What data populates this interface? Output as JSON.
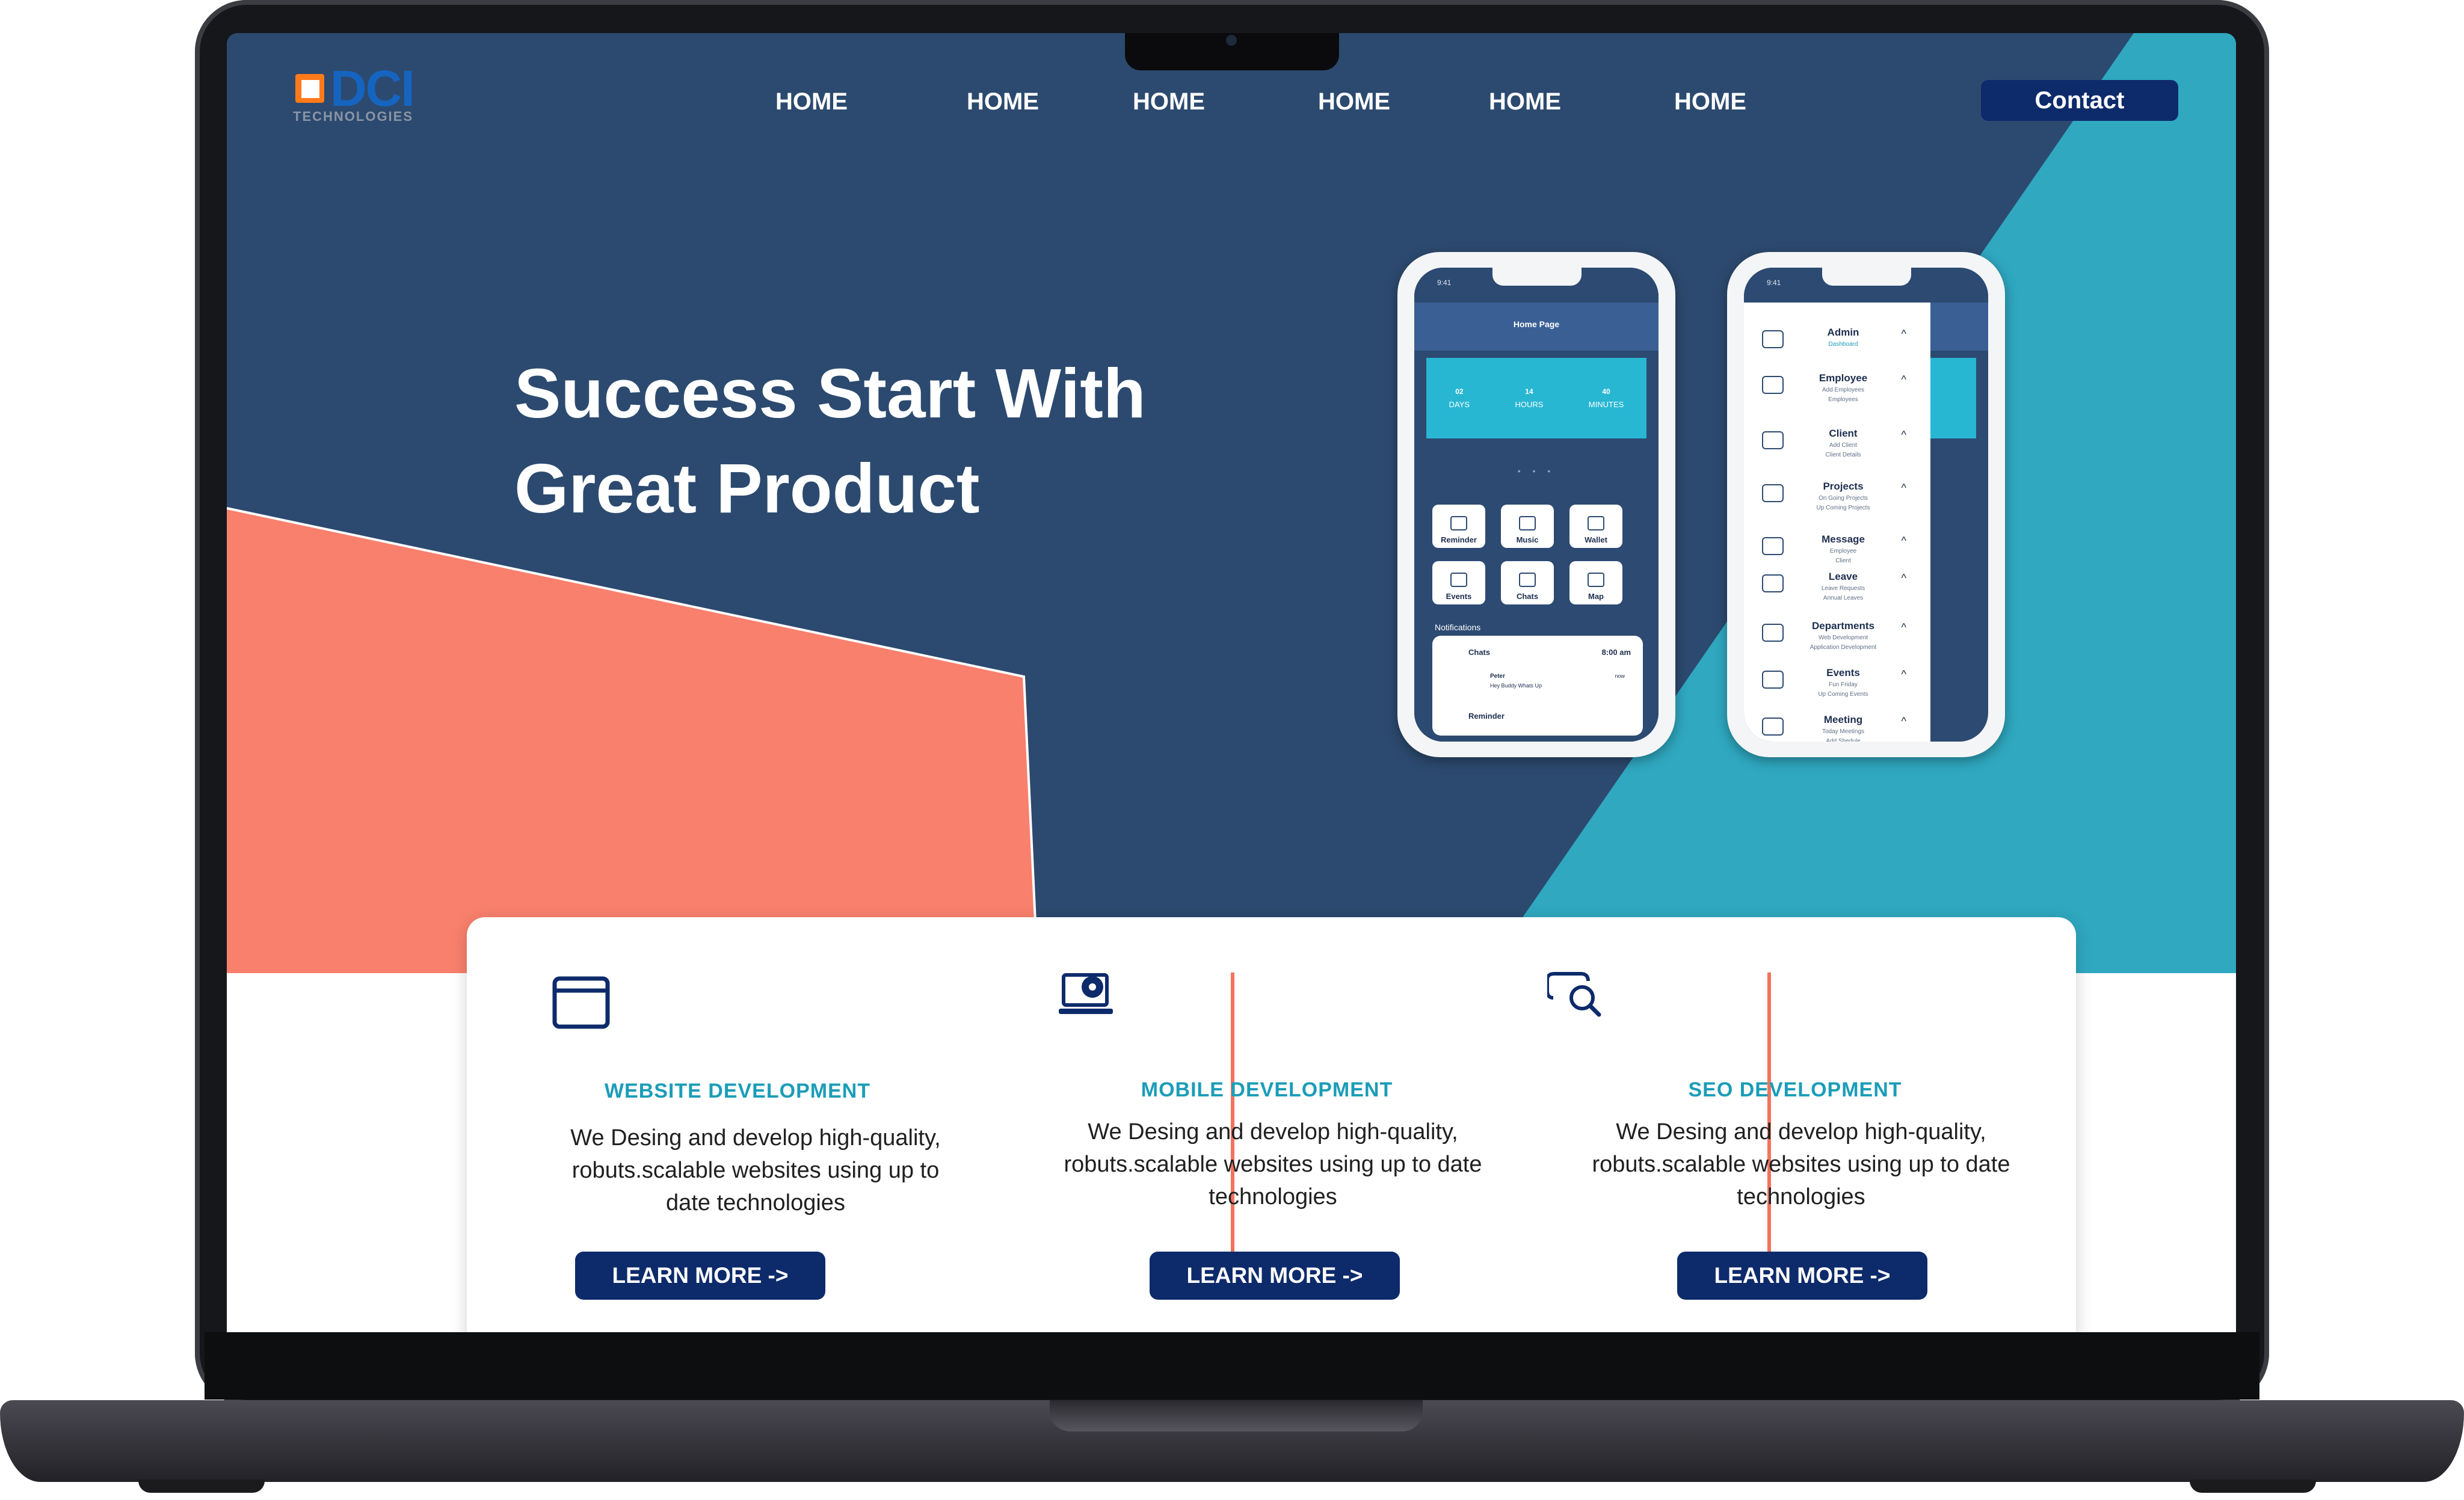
{
  "brand": {
    "logo_text": "DCI",
    "logo_subtext": "TECHNOLOGIES"
  },
  "nav": {
    "items": [
      "HOME",
      "HOME",
      "HOME",
      "HOME",
      "HOME",
      "HOME"
    ],
    "contact_label": "Contact"
  },
  "hero": {
    "title_line1": "Success Start With",
    "title_line2": "Great Product"
  },
  "phone_left": {
    "status_time": "9:41",
    "header_title": "Home Page",
    "counters": [
      {
        "value": "02",
        "label": "DAYS"
      },
      {
        "value": "14",
        "label": "HOURS"
      },
      {
        "value": "40",
        "label": "MINUTES"
      }
    ],
    "tiles": [
      "Reminder",
      "Music",
      "Wallet",
      "Events",
      "Chats",
      "Map"
    ],
    "notifications_label": "Notifications",
    "notification_chat": {
      "title": "Chats",
      "time": "8:00 am",
      "sender": "Peter",
      "message": "Hey Buddy Whats Up",
      "when": "now"
    },
    "notification_reminder": "Reminder"
  },
  "phone_right": {
    "status_time": "9:41",
    "menu": [
      {
        "title": "Admin",
        "sub": "Dashboard"
      },
      {
        "title": "Employee",
        "sub": "Add Employees\nEmployees"
      },
      {
        "title": "Client",
        "sub": "Add Client\nClient Details"
      },
      {
        "title": "Projects",
        "sub": "On Going Projects\nUp Coming Projects"
      },
      {
        "title": "Message",
        "sub": "Employee\nClient"
      },
      {
        "title": "Leave",
        "sub": "Leave Requests\nAnnual Leaves"
      },
      {
        "title": "Departments",
        "sub": "Web Development\nApplication Development"
      },
      {
        "title": "Events",
        "sub": "Fun Friday\nUp Coming Events"
      },
      {
        "title": "Meeting",
        "sub": "Today Meetings\nAdd Shedule"
      }
    ]
  },
  "services": [
    {
      "icon": "browser-window-icon",
      "title": "WEBSITE DEVELOPMENT",
      "description": "We Desing and develop high-quality, robuts.scalable websites using up to date technologies",
      "button": "LEARN MORE ->"
    },
    {
      "icon": "laptop-gear-icon",
      "title": "MOBILE DEVELOPMENT",
      "description": "We Desing and develop high-quality, robuts.scalable websites using up to date technologies",
      "button": "LEARN MORE ->"
    },
    {
      "icon": "seo-search-icon",
      "title": "SEO DEVELOPMENT",
      "description": "We Desing and develop high-quality, robuts.scalable websites using up to date technologies",
      "button": "LEARN MORE ->"
    }
  ],
  "colors": {
    "navy_bg": "#2c4a6f",
    "teal": "#2fa8c0",
    "coral": "#f9806d",
    "button_navy": "#0d2b6b",
    "service_title": "#1b9db8"
  }
}
